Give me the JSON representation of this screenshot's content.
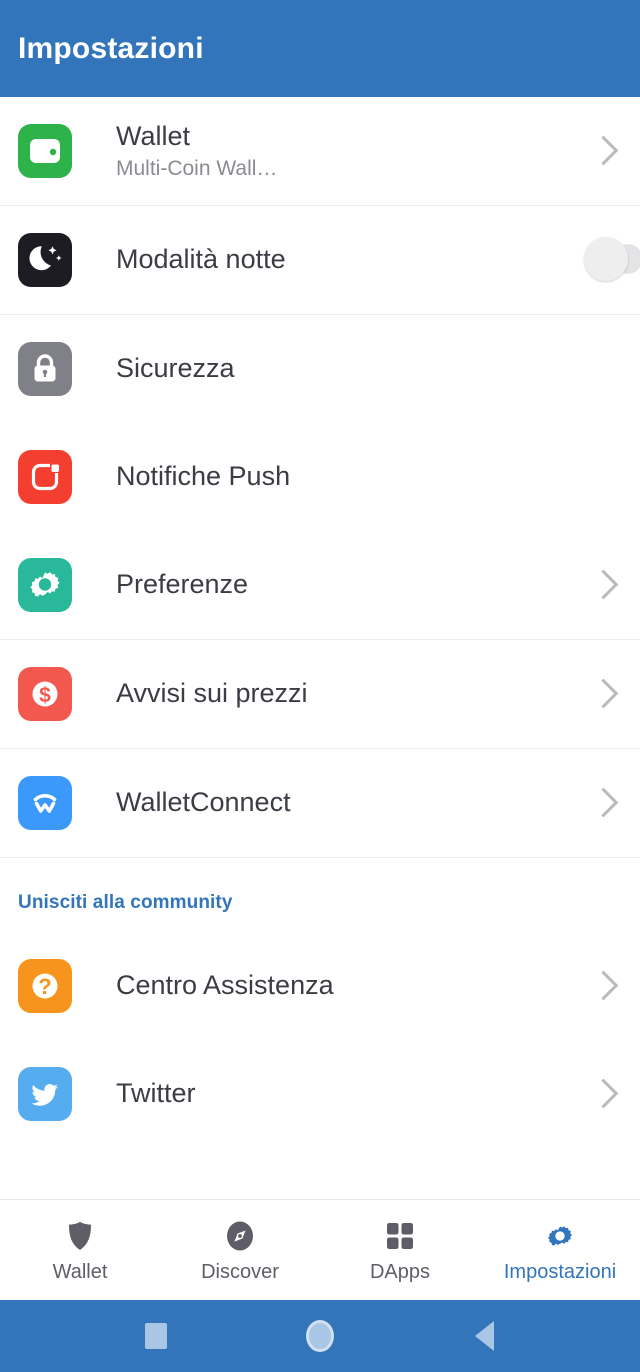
{
  "app": {
    "title": "Impostazioni",
    "header_bg": "#3375bb",
    "accent": "#3375bb"
  },
  "settings": {
    "rows": [
      {
        "key": "wallet",
        "label": "Wallet",
        "subtitle": "Multi-Coin Wall…",
        "icon": "wallet-icon",
        "icon_bg": "#2eb24a",
        "accessory": "chevron"
      },
      {
        "key": "night-mode",
        "label": "Modalità notte",
        "subtitle": "",
        "icon": "moon-icon",
        "icon_bg": "#1c1c22",
        "accessory": "toggle",
        "toggle_on": false
      },
      {
        "key": "security",
        "label": "Sicurezza",
        "subtitle": "",
        "icon": "lock-icon",
        "icon_bg": "#808089",
        "accessory": "none"
      },
      {
        "key": "push-notifications",
        "label": "Notifiche Push",
        "subtitle": "",
        "icon": "notification-icon",
        "icon_bg": "#f43e2f",
        "accessory": "none"
      },
      {
        "key": "preferences",
        "label": "Preferenze",
        "subtitle": "",
        "icon": "gear-icon",
        "icon_bg": "#29b99a",
        "accessory": "chevron"
      },
      {
        "key": "price-alerts",
        "label": "Avvisi sui prezzi",
        "subtitle": "",
        "icon": "dollar-alert-icon",
        "icon_bg": "#f3584f",
        "accessory": "chevron"
      },
      {
        "key": "walletconnect",
        "label": "WalletConnect",
        "subtitle": "",
        "icon": "walletconnect-icon",
        "icon_bg": "#3b99fc",
        "accessory": "chevron"
      }
    ]
  },
  "community": {
    "header": "Unisciti alla community",
    "rows": [
      {
        "key": "help-center",
        "label": "Centro Assistenza",
        "icon": "question-icon",
        "icon_bg": "#f7941e",
        "accessory": "chevron"
      },
      {
        "key": "twitter",
        "label": "Twitter",
        "icon": "twitter-icon",
        "icon_bg": "#55acee",
        "accessory": "chevron"
      }
    ]
  },
  "tabbar": {
    "tabs": [
      {
        "key": "wallet",
        "label": "Wallet",
        "icon": "shield-icon",
        "active": false
      },
      {
        "key": "discover",
        "label": "Discover",
        "icon": "compass-icon",
        "active": false
      },
      {
        "key": "dapps",
        "label": "DApps",
        "icon": "grid-icon",
        "active": false
      },
      {
        "key": "settings",
        "label": "Impostazioni",
        "icon": "gear-icon",
        "active": true
      }
    ]
  },
  "sysnav": {
    "recents": "recents-square-button",
    "home": "home-circle-button",
    "back": "back-triangle-button"
  }
}
